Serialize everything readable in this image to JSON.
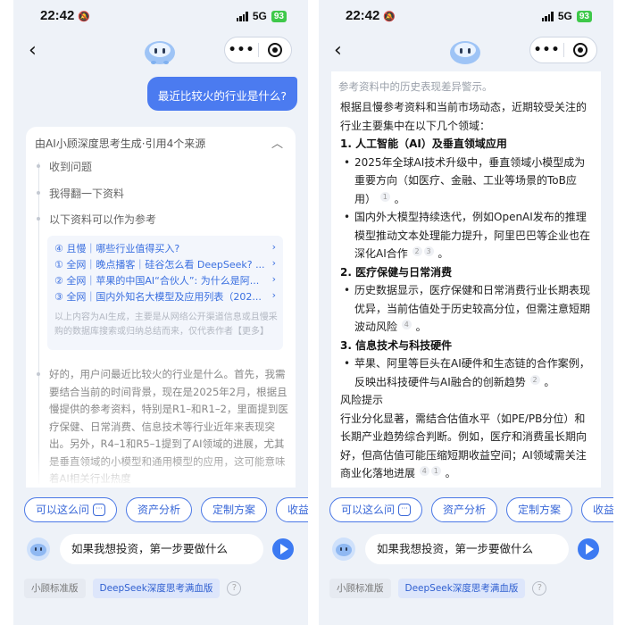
{
  "status": {
    "time": "22:42",
    "network": "5G",
    "battery": "93"
  },
  "nav": {
    "more_label": "•••"
  },
  "chat": {
    "user_message": "最近比较火的行业是什么?"
  },
  "card": {
    "header": "由AI小顾深度思考生成·引用4个来源",
    "steps": [
      "收到问题",
      "我得翻一下资料",
      "以下资料可以作为参考"
    ],
    "sources": [
      "④ 且慢｜哪些行业值得买入?",
      "① 全网｜晚点播客｜硅谷怎么看 DeepSeek? ...",
      "② 全网｜苹果的中国AI“合伙人”: 为什么是阿...",
      "③ 全网｜国内外知名大模型及应用列表（202..."
    ],
    "source_note": "以上内容为AI生成，主要是从网络公开渠道信息或且慢采购的数据库搜索或归纳总结而来，仅代表作者【更多】",
    "thinking": "好的，用户问最近比较火的行业是什么。首先，我需要结合当前的时间背景，现在是2025年2月，根据且慢提供的参考资料，特别是R1–和R1–2，里面提到医疗保健、日常消费、信息技术等行业近年来表现突出。另外，R4–1和R5–1提到了AI领域的进展，尤其是垂直领域的小模型和通用模型的应用，这可能意味着AI相关行业热度"
  },
  "answer": {
    "top_line": "参考资料中的历史表现差异警示。",
    "intro": "根据且慢参考资料和当前市场动态，近期较受关注的行业主要集中在以下几个领域：",
    "sections": [
      {
        "title": "1. 人工智能（AI）及垂直领域应用",
        "bullets": [
          {
            "text": "2025年全球AI技术升级中，垂直领域小模型成为重要方向（如医疗、金融、工业等场景的ToB应用）",
            "refs": "1"
          },
          {
            "text": "国内外大模型持续迭代，例如OpenAI发布的推理模型推动文本处理能力提升，阿里巴巴等企业也在深化AI合作",
            "refs": "2 3"
          }
        ]
      },
      {
        "title": "2. 医疗保健与日常消费",
        "bullets": [
          {
            "text": "历史数据显示，医疗保健和日常消费行业长期表现优异，当前估值处于历史较高分位，但需注意短期波动风险",
            "refs": "4"
          }
        ]
      },
      {
        "title": "3. 信息技术与科技硬件",
        "bullets": [
          {
            "text": "苹果、阿里等巨头在AI硬件和生态链的合作案例，反映出科技硬件与AI融合的创新趋势",
            "refs": "2"
          }
        ]
      }
    ],
    "risk_title": "风险提示",
    "risk_text": "行业分化显著，需结合估值水平（如PE/PB分位）和长期产业趋势综合判断。例如，医疗和消费虽长期向好，但高估值可能压缩短期收益空间；AI领域需关注商业化落地进展",
    "risk_refs": "4 1"
  },
  "chips": [
    "可以这么问",
    "资产分析",
    "定制方案",
    "收益"
  ],
  "input": {
    "value": "如果我想投资，第一步要做什么"
  },
  "modes": [
    "小顾标准版",
    "DeepSeek深度思考满血版"
  ],
  "colors": {
    "accent": "#4b7bf0",
    "background": "#eef2f8"
  }
}
